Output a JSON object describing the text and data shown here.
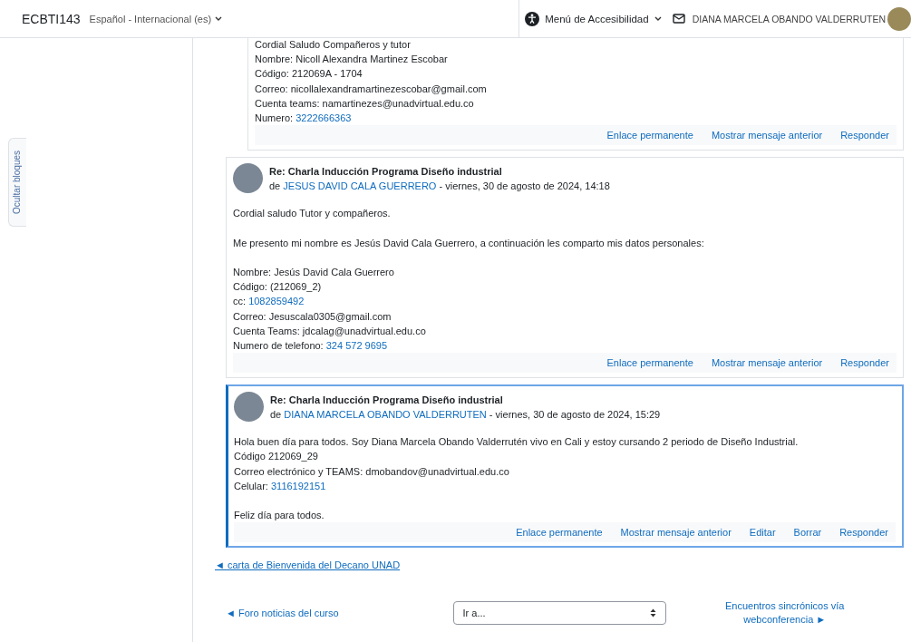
{
  "header": {
    "site": "ECBTI143",
    "language": "Español - Internacional (es)",
    "accessibility_menu": "Menú de Accesibilidad",
    "user_name": "DIANA MARCELA OBANDO VALDERRUTEN"
  },
  "sidebar_toggle": "Ocultar bloques",
  "posts": [
    {
      "kind": "nested",
      "highlighted": false,
      "body": [
        [
          {
            "text": "Cordial Saludo Compañeros y tutor"
          },
          {
            "text": "Nombre: Nicoll Alexandra Martinez Escobar"
          },
          {
            "text": "Código: 212069A - 1704"
          },
          {
            "text": "Correo: nicollalexandramartinezescobar@gmail.com"
          },
          {
            "text": "Cuenta teams: namartinezes@unadvirtual.edu.co"
          },
          {
            "text": "Numero: ",
            "link": "3222666363"
          }
        ]
      ],
      "actions": [
        "Enlace permanente",
        "Mostrar mensaje anterior",
        "Responder"
      ]
    },
    {
      "kind": "reply",
      "highlighted": false,
      "subject": "Re: Charla Inducción Programa Diseño industrial",
      "by": "de ",
      "author": "JESUS DAVID CALA GUERRERO",
      "date": " - viernes, 30 de agosto de 2024, 14:18",
      "body": [
        [
          {
            "text": "Cordial saludo Tutor y compañeros."
          }
        ],
        [
          {
            "text": "Me presento mi nombre es Jesús David Cala Guerrero, a continuación les comparto mis datos personales:"
          }
        ],
        [
          {
            "text": "Nombre: Jesús David Cala Guerrero"
          },
          {
            "text": "Código: (212069_2)"
          },
          {
            "text": "cc: ",
            "link": "1082859492"
          },
          {
            "text": "Correo: Jesuscala0305@gmail.com"
          },
          {
            "text": "Cuenta Teams: jdcalag@unadvirtual.edu.co"
          },
          {
            "text": "Numero de telefono: ",
            "link": "324 572 9695"
          }
        ]
      ],
      "actions": [
        "Enlace permanente",
        "Mostrar mensaje anterior",
        "Responder"
      ]
    },
    {
      "kind": "reply",
      "highlighted": true,
      "subject": "Re: Charla Inducción Programa Diseño industrial",
      "by": "de ",
      "author": "DIANA MARCELA OBANDO VALDERRUTEN",
      "date": " - viernes, 30 de agosto de 2024, 15:29",
      "body": [
        [
          {
            "text": "Hola buen día para todos. Soy Diana Marcela Obando Valderrutén vivo en Cali y estoy cursando 2 periodo de Diseño Industrial."
          },
          {
            "text": "Código 212069_29"
          },
          {
            "text": "Correo electrónico y TEAMS: dmobandov@unadvirtual.edu.co"
          },
          {
            "text": "Celular: ",
            "link": "3116192151"
          }
        ],
        [
          {
            "text": "Feliz día para todos."
          }
        ]
      ],
      "actions": [
        "Enlace permanente",
        "Mostrar mensaje anterior",
        "Editar",
        "Borrar",
        "Responder"
      ]
    }
  ],
  "previous_discussion": "◄ carta de Bienvenida del Decano UNAD",
  "navigation": {
    "previous": "◄ Foro noticias del curso",
    "jump_placeholder": "Ir a...",
    "next": "Encuentros sincrónicos vía webconferencia ►"
  }
}
